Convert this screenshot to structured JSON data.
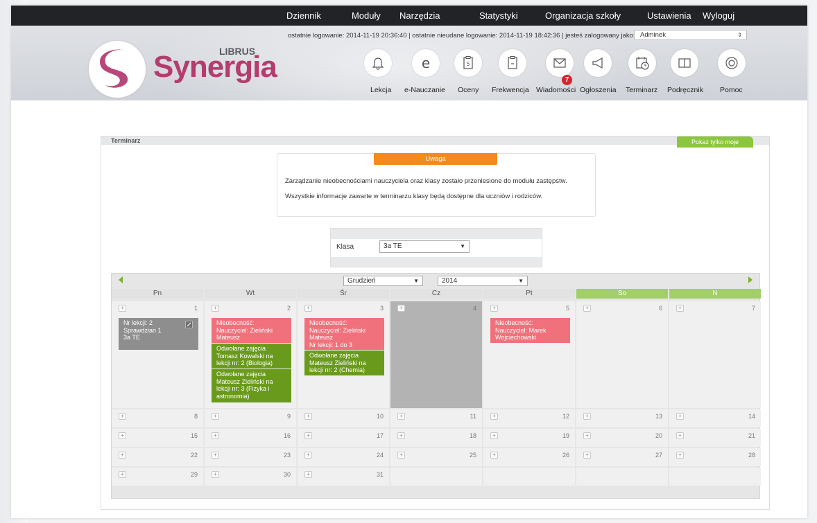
{
  "nav": {
    "items": [
      "Dziennik",
      "Moduły",
      "Narzędzia",
      "Statystyki",
      "Organizacja szkoły",
      "Ustawienia",
      "Wyloguj"
    ]
  },
  "header": {
    "login_info": "ostatnie logowanie: 2014-11-19 20:36:40  |  ostatnie nieudane logowanie: 2014-11-19 18:42:36  |  jesteś zalogowany jako:",
    "user": "Adminek",
    "logo_small": "LIBRUS",
    "logo_main": "Synergia"
  },
  "modules": [
    {
      "label": "Lekcja",
      "icon": "bell-icon"
    },
    {
      "label": "e-Nauczanie",
      "icon": "e-icon"
    },
    {
      "label": "Oceny",
      "icon": "grade-card-icon"
    },
    {
      "label": "Frekwencja",
      "icon": "attendance-card-icon"
    },
    {
      "label": "Wiadomości",
      "icon": "envelope-icon",
      "badge": "7"
    },
    {
      "label": "Ogłoszenia",
      "icon": "megaphone-icon"
    },
    {
      "label": "Terminarz",
      "icon": "calendar-clock-icon"
    },
    {
      "label": "Podręcznik",
      "icon": "book-icon"
    },
    {
      "label": "Pomoc",
      "icon": "lifebuoy-icon"
    }
  ],
  "panel": {
    "title": "Terminarz",
    "show_mine_button": "Pokaż tylko moje"
  },
  "notice": {
    "title": "Uwaga",
    "line1": "Zarządzanie nieobecnościami nauczyciela oraz klasy zostało przeniesione do modułu zastępstw.",
    "line2": "Wszystkie informacje zawarte w terminarzu klasy będą dostępne dla uczniów i rodziców."
  },
  "class_filter": {
    "label": "Klasa",
    "value": "3a TE"
  },
  "calendar": {
    "month": "Grudzień",
    "year": "2014",
    "days": [
      "Pn",
      "Wt",
      "Śr",
      "Cz",
      "Pt",
      "So",
      "N"
    ],
    "weeks": [
      [
        "1",
        "2",
        "3",
        "4",
        "5",
        "6",
        "7"
      ],
      [
        "8",
        "9",
        "10",
        "11",
        "12",
        "13",
        "14"
      ],
      [
        "15",
        "16",
        "17",
        "18",
        "19",
        "20",
        "21"
      ],
      [
        "22",
        "23",
        "24",
        "25",
        "26",
        "27",
        "28"
      ],
      [
        "29",
        "30",
        "31",
        "",
        "",
        "",
        ""
      ]
    ],
    "events": {
      "mon1": "Nr lekcji: 2\nSprawdzian 1\n3a TE",
      "tue_absence": "Nieobecność:\nNauczyciel: Zieliński\nMateusz",
      "tue_cancel1": "Odwołane zajęcia\nTomasz Kowalski na\nlekcji nr: 2 (Biologia)",
      "tue_cancel2": "Odwołane zajęcia\nMateusz Zieliński na\nlekcji nr: 3 (Fizyka i\nastronomia)",
      "wed_absence": "Nieobecność:\nNauczyciel: Zieliński\nMateusz\nNr lekcji: 1 do 3",
      "wed_cancel": "Odwołane zajęcia\nMateusz Zieliński na\nlekcji nr: 2 (Chemia)",
      "fri_absence": "Nieobecność:\nNauczyciel: Marek\nWojciechowski"
    }
  },
  "colors": {
    "accent_green": "#8cc63f",
    "notice_orange": "#f28b1e",
    "absence_red": "#f0717b",
    "cancel_green": "#6a9a1c",
    "brand": "#b43d6e"
  }
}
